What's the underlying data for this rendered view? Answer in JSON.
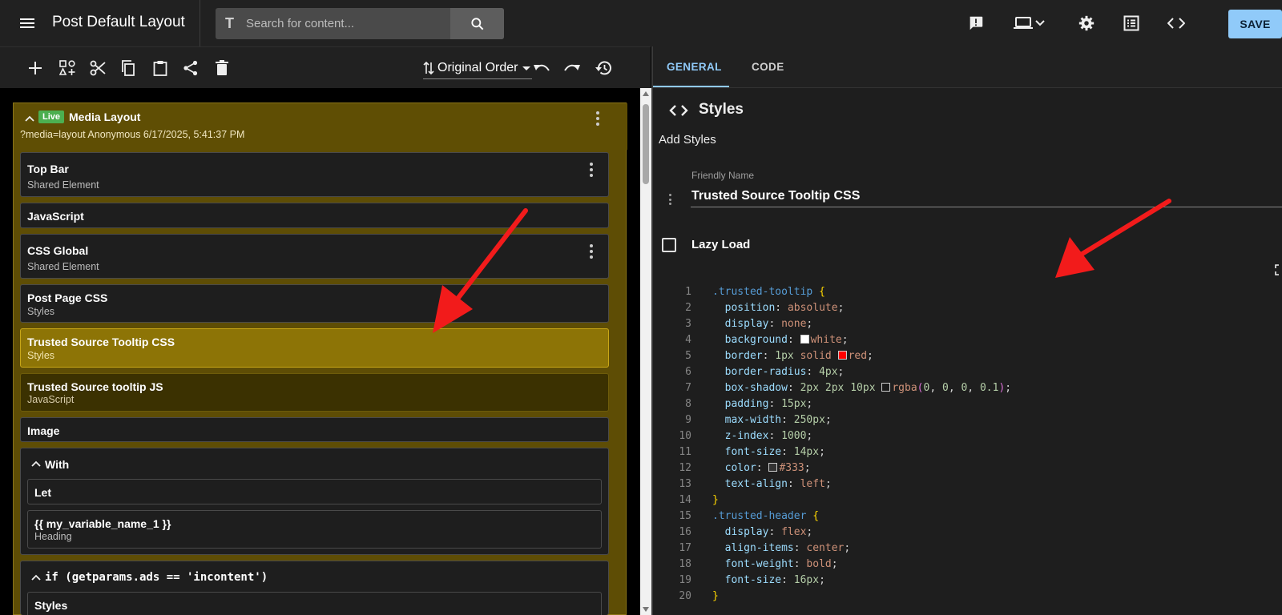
{
  "app": {
    "title": "Post Default Layout",
    "search_placeholder": "Search for content...",
    "save_label": "SAVE"
  },
  "toolbar": {
    "order_label": "Original Order"
  },
  "layout": {
    "badge": "Live",
    "title": "Media Layout",
    "subtitle": "?media=layout Anonymous 6/17/2025, 5:41:37 PM",
    "items": [
      {
        "title": "Top Bar",
        "subtitle": "Shared Element"
      },
      {
        "title": "JavaScript",
        "subtitle": ""
      },
      {
        "title": "CSS Global",
        "subtitle": "Shared Element"
      },
      {
        "title": "Post Page CSS",
        "subtitle": "Styles"
      },
      {
        "title": "Trusted Source Tooltip CSS",
        "subtitle": "Styles"
      },
      {
        "title": "Trusted Source tooltip JS",
        "subtitle": "JavaScript"
      },
      {
        "title": "Image",
        "subtitle": ""
      }
    ],
    "with_block": {
      "title": "With",
      "children": [
        {
          "title": "Let",
          "subtitle": ""
        },
        {
          "title": "{{ my_variable_name_1 }}",
          "subtitle": "Heading"
        }
      ]
    },
    "if_block": {
      "title": "if (getparams.ads == 'incontent')",
      "child_title": "Styles"
    }
  },
  "panel": {
    "tabs": [
      "GENERAL",
      "CODE"
    ],
    "section_title": "Styles",
    "add_styles_label": "Add Styles",
    "friendly_name_label": "Friendly Name",
    "friendly_name_value": "Trusted Source Tooltip CSS",
    "lazy_load_label": "Lazy Load",
    "lazy_load_checked": false
  },
  "code": {
    "line_numbers": [
      "1",
      "2",
      "3",
      "4",
      "5",
      "6",
      "7",
      "8",
      "9",
      "10",
      "11",
      "12",
      "13",
      "14",
      "15",
      "16",
      "17",
      "18",
      "19",
      "20"
    ],
    "lines": [
      ".trusted-tooltip {",
      "  position: absolute;",
      "  display: none;",
      "  background: white;",
      "  border: 1px solid red;",
      "  border-radius: 4px;",
      "  box-shadow: 2px 2px 10px rgba(0, 0, 0, 0.1);",
      "  padding: 15px;",
      "  max-width: 250px;",
      "  z-index: 1000;",
      "  font-size: 14px;",
      "  color: #333;",
      "  text-align: left;",
      "}",
      ".trusted-header {",
      "  display: flex;",
      "  align-items: center;",
      "  font-weight: bold;",
      "  font-size: 16px;",
      "}"
    ]
  },
  "colors": {
    "accent": "#90caf9",
    "selected_item": "#8d7406",
    "layout_bg": "#5e4d05",
    "live_badge": "#4caf50",
    "annotation_arrow": "#f21b1b"
  },
  "icons": [
    "menu-icon",
    "search-icon",
    "feedback-icon",
    "laptop-icon",
    "chevron-down-icon",
    "gear-icon",
    "list-icon",
    "code-icon",
    "add-icon",
    "add-element-icon",
    "cut-icon",
    "copy-icon",
    "paste-icon",
    "share-icon",
    "delete-icon",
    "sort-icon",
    "undo-icon",
    "redo-icon",
    "history-icon",
    "chevron-up-icon",
    "more-vert-icon",
    "drag-handle-icon",
    "expand-icon"
  ]
}
